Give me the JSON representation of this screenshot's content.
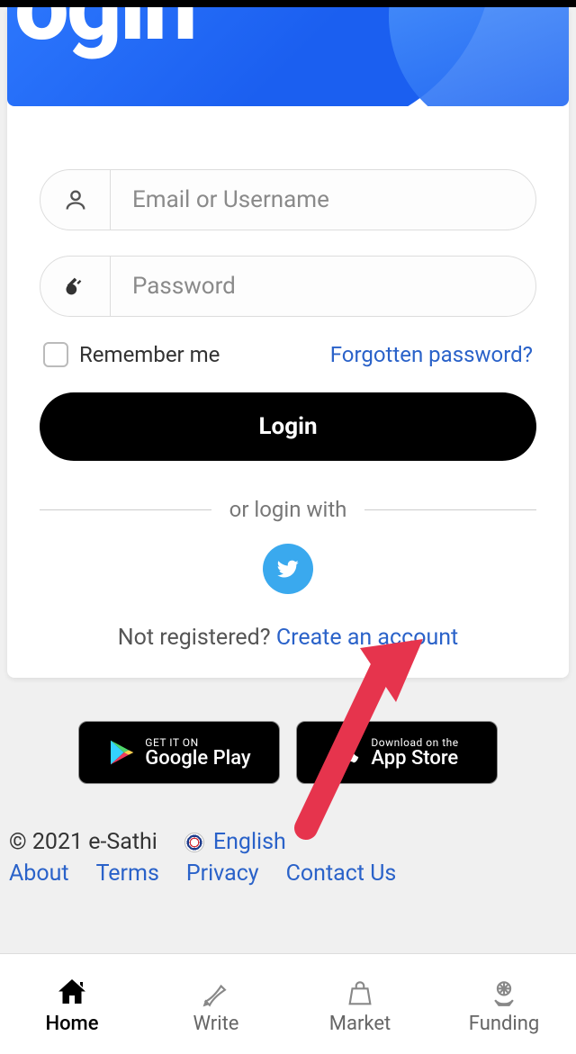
{
  "hero": {
    "title": "ogin"
  },
  "inputs": {
    "email_placeholder": "Email or Username",
    "password_placeholder": "Password"
  },
  "options": {
    "remember_label": "Remember me",
    "forgot_label": "Forgotten password?"
  },
  "login_button": "Login",
  "divider": "or login with",
  "register": {
    "prompt": "Not registered? ",
    "link": "Create an account"
  },
  "stores": {
    "google": {
      "small": "GET IT ON",
      "large": "Google Play"
    },
    "apple": {
      "small": "Download on the",
      "large": "App Store"
    }
  },
  "footer": {
    "copyright": "© 2021 e-Sathi",
    "language": "English",
    "links": {
      "about": "About",
      "terms": "Terms",
      "privacy": "Privacy",
      "contact": "Contact Us"
    }
  },
  "nav": {
    "home": "Home",
    "write": "Write",
    "market": "Market",
    "funding": "Funding"
  }
}
